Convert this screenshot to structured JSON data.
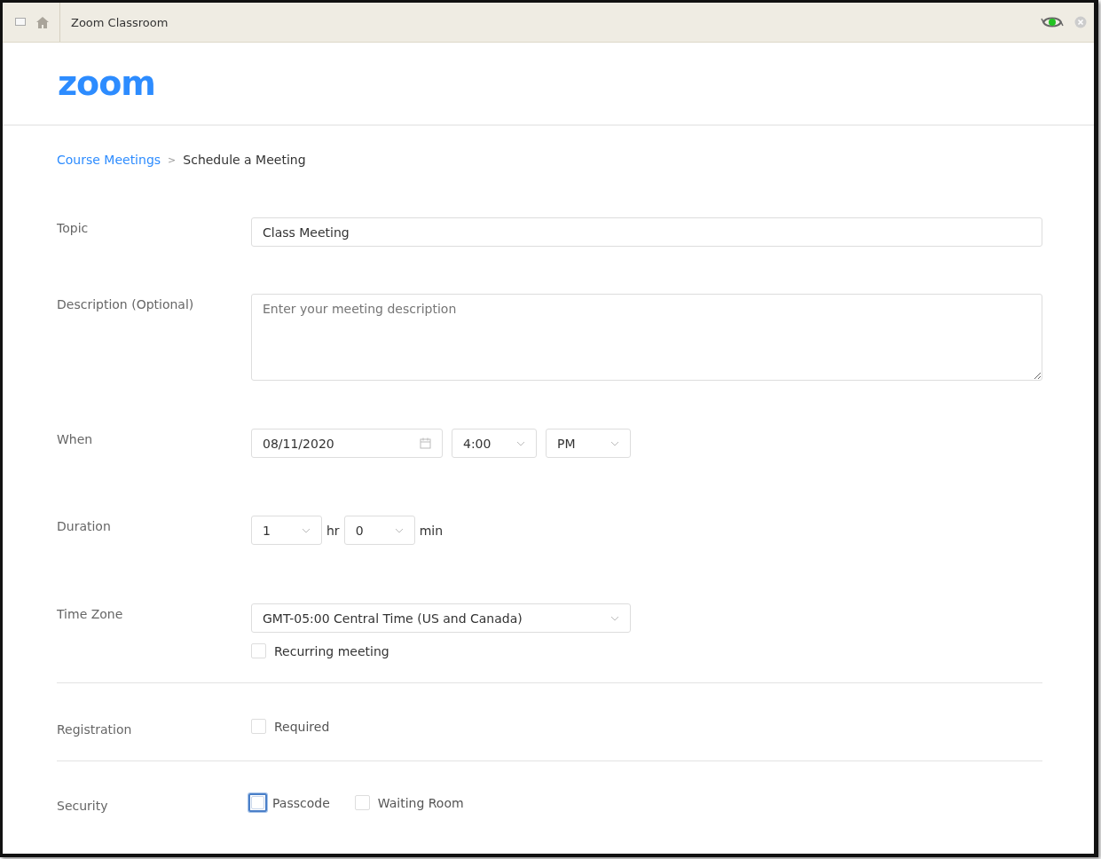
{
  "window": {
    "title": "Zoom Classroom"
  },
  "logo": "zoom",
  "breadcrumb": [
    {
      "label": "Course Meetings",
      "kind": "link"
    },
    {
      "label": ">",
      "kind": "separator"
    },
    {
      "label": "Schedule a Meeting",
      "kind": "current"
    }
  ],
  "sections": [
    {
      "rows": [
        {
          "label": "Topic",
          "kind": "topic",
          "controls": [
            {
              "kind": "input",
              "value": "Class Meeting"
            }
          ]
        },
        {
          "label": "Description (Optional)",
          "kind": "description",
          "controls": [
            {
              "kind": "textarea",
              "placeholder": "Enter your meeting description"
            }
          ]
        },
        {
          "label": "When",
          "kind": "when",
          "controls": [
            {
              "kind": "date",
              "value": "08/11/2020"
            },
            {
              "kind": "select",
              "value": "4:00"
            },
            {
              "kind": "select",
              "value": "PM"
            }
          ]
        },
        {
          "label": "Duration",
          "kind": "duration",
          "controls": [
            {
              "kind": "select",
              "value": "1"
            },
            {
              "kind": "unit",
              "value": "hr"
            },
            {
              "kind": "select",
              "value": "0"
            },
            {
              "kind": "unit",
              "value": "min"
            }
          ]
        },
        {
          "label": "Time Zone",
          "kind": "zone",
          "controls": [
            {
              "kind": "wide-select",
              "value": "GMT-05:00 Central Time (US and Canada)"
            }
          ],
          "options": [
            {
              "label": "Recurring meeting",
              "checked": false,
              "focused": false
            }
          ]
        }
      ]
    },
    {
      "rows": [
        {
          "label": "Registration",
          "kind": "plain",
          "options": [
            {
              "label": "Required",
              "checked": false,
              "focused": false
            }
          ]
        }
      ]
    },
    {
      "rows": [
        {
          "label": "Security",
          "kind": "plain",
          "options": [
            {
              "label": "Passcode",
              "checked": false,
              "focused": true
            },
            {
              "label": "Waiting Room",
              "checked": false,
              "focused": false
            }
          ]
        }
      ]
    }
  ]
}
